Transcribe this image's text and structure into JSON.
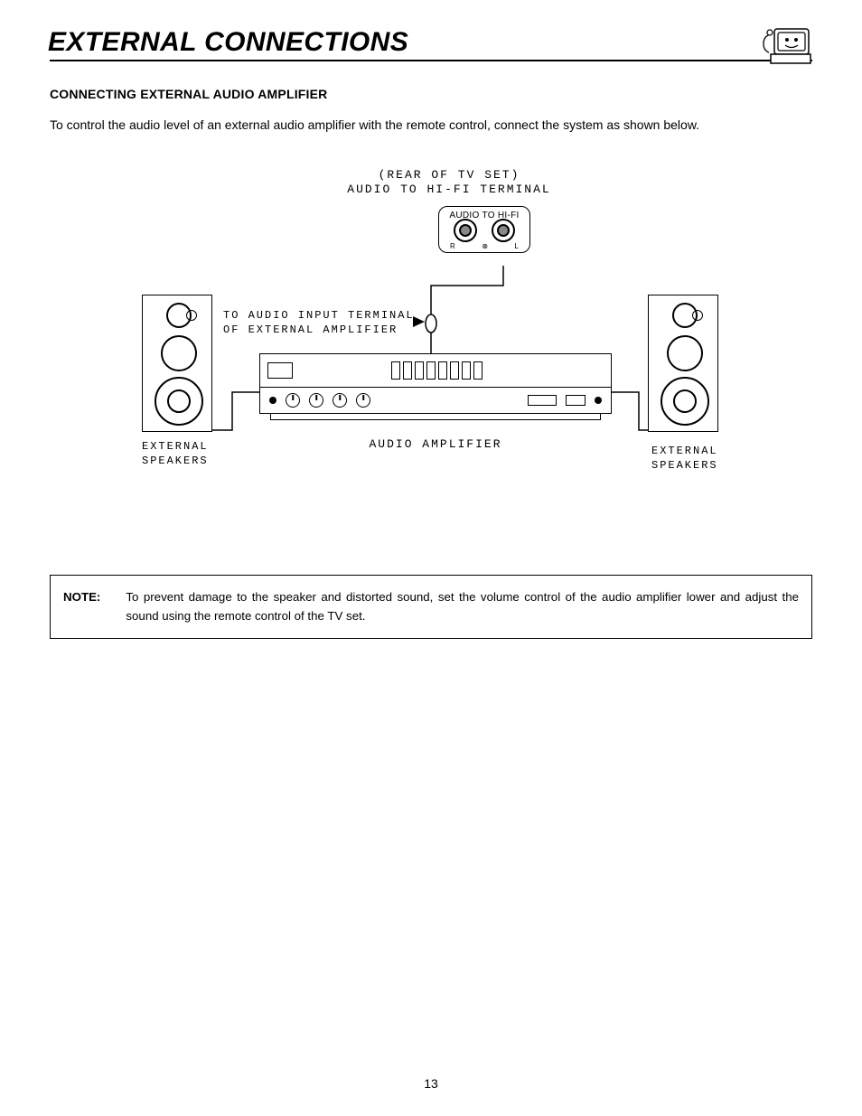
{
  "header": {
    "title": "EXTERNAL CONNECTIONS"
  },
  "section": {
    "subtitle": "CONNECTING EXTERNAL AUDIO AMPLIFIER"
  },
  "intro": "To control the audio level of an external audio amplifier with the remote control, connect the system as shown below.",
  "diagram": {
    "top_line1": "(REAR OF TV SET)",
    "top_line2": "AUDIO TO HI-FI TERMINAL",
    "terminal_label": "AUDIO TO HI-FI",
    "jack_r": "R",
    "jack_l": "L",
    "mid_line1": "TO AUDIO INPUT TERMINAL",
    "mid_line2": "OF EXTERNAL AMPLIFIER",
    "amp_label": "AUDIO AMPLIFIER",
    "spk_left_line1": "EXTERNAL",
    "spk_left_line2": "SPEAKERS",
    "spk_right_line1": "EXTERNAL",
    "spk_right_line2": "SPEAKERS"
  },
  "note": {
    "label": "NOTE:",
    "text": "To prevent damage to the speaker and distorted sound, set the volume control of the audio amplifier lower and adjust the sound using the remote control of the TV set."
  },
  "page_number": "13"
}
